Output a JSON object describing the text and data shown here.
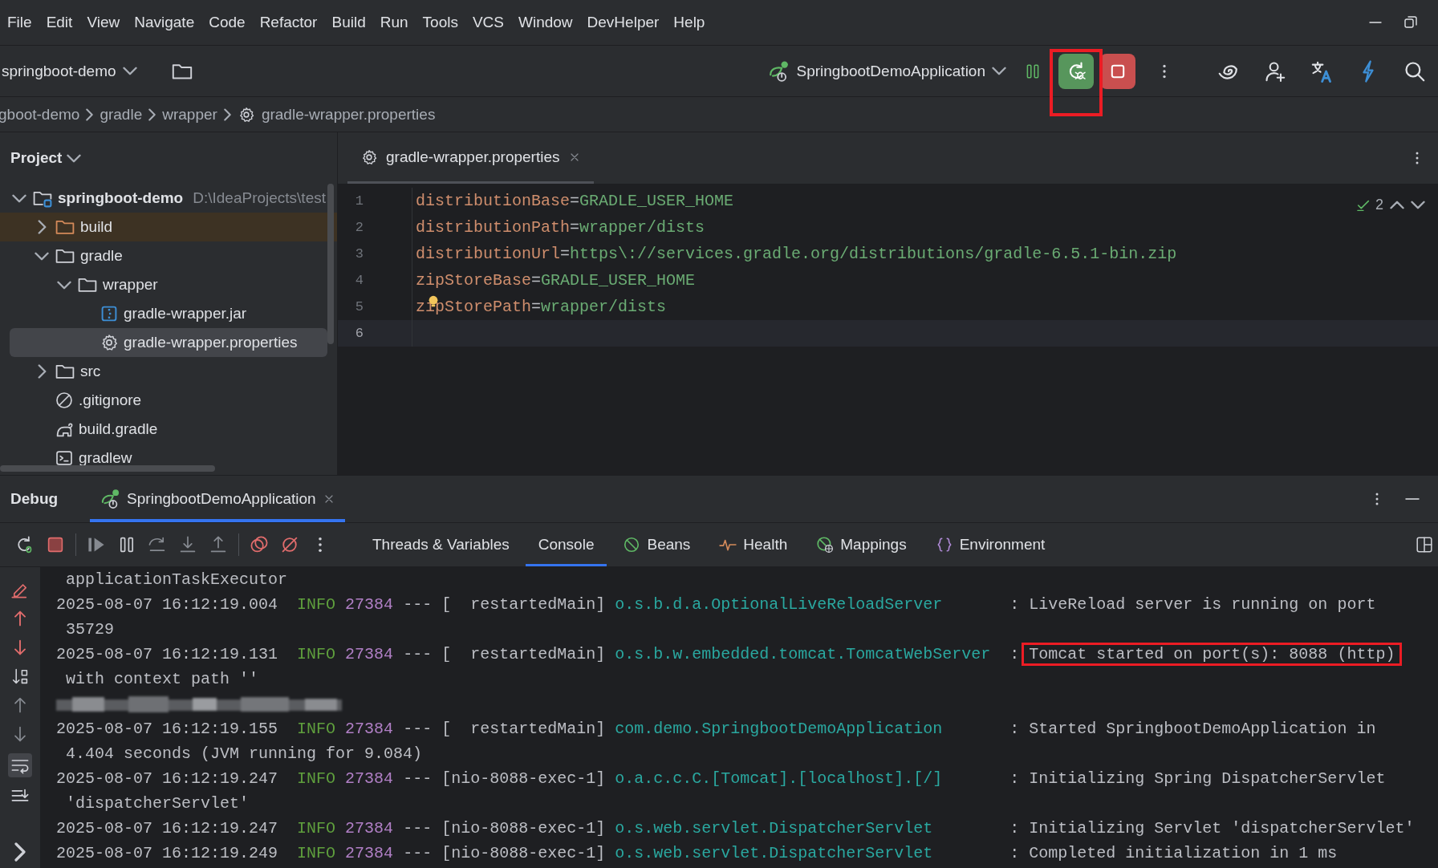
{
  "menu": [
    "File",
    "Edit",
    "View",
    "Navigate",
    "Code",
    "Refactor",
    "Build",
    "Run",
    "Tools",
    "VCS",
    "Window",
    "DevHelper",
    "Help"
  ],
  "toolbar": {
    "project": "springboot-demo",
    "run_config": "SpringbootDemoApplication",
    "buttons": [
      {
        "kind": "debug",
        "highlighted": true
      },
      {
        "kind": "stop"
      }
    ]
  },
  "breadcrumbs": [
    "gboot-demo",
    "gradle",
    "wrapper",
    "gradle-wrapper.properties"
  ],
  "project": {
    "title": "Project",
    "tree": [
      {
        "label": "springboot-demo",
        "kind": "module",
        "path": "D:\\IdeaProjects\\test",
        "expanded": true,
        "selected": false,
        "children": [
          {
            "label": "build",
            "kind": "excluded",
            "expanded": false,
            "selected": false
          },
          {
            "label": "gradle",
            "kind": "folder",
            "expanded": true,
            "selected": false,
            "children": [
              {
                "label": "wrapper",
                "kind": "folder",
                "expanded": true,
                "selected": false,
                "children": [
                  {
                    "label": "gradle-wrapper.jar",
                    "kind": "jar",
                    "selected": false
                  },
                  {
                    "label": "gradle-wrapper.properties",
                    "kind": "properties",
                    "selected": true
                  }
                ]
              }
            ]
          },
          {
            "label": "src",
            "kind": "folder",
            "expanded": false,
            "selected": false
          },
          {
            "label": ".gitignore",
            "kind": "ignore",
            "selected": false
          },
          {
            "label": "build.gradle",
            "kind": "gradle",
            "selected": false
          },
          {
            "label": "gradlew",
            "kind": "script",
            "selected": false
          }
        ]
      }
    ]
  },
  "editor": {
    "tabs": [
      {
        "label": "gradle-wrapper.properties",
        "selected": true
      }
    ],
    "inspections": "2",
    "lines": [
      {
        "number": "1",
        "key": "distributionBase",
        "eq": "=",
        "value": "GRADLE_USER_HOME",
        "current": false
      },
      {
        "number": "2",
        "key": "distributionPath",
        "eq": "=",
        "value": "wrapper/dists",
        "current": false
      },
      {
        "number": "3",
        "key": "distributionUrl",
        "eq": "=",
        "value": "https\\://services.gradle.org/distributions/gradle-6.5.1-bin.zip",
        "current": false
      },
      {
        "number": "4",
        "key": "zipStoreBase",
        "eq": "=",
        "value": "GRADLE_USER_HOME",
        "current": false
      },
      {
        "number": "5",
        "key": "zipStorePath",
        "eq": "=",
        "value": "wrapper/dists",
        "current": false,
        "bulb": true
      },
      {
        "number": "6",
        "current": true
      }
    ]
  },
  "debug": {
    "title": "Debug",
    "sessions": [
      {
        "label": "SpringbootDemoApplication",
        "selected": true
      }
    ],
    "tabs": [
      {
        "label": "Threads & Variables",
        "kind": "plain",
        "selected": false
      },
      {
        "label": "Console",
        "kind": "plain",
        "selected": true
      },
      {
        "label": "Beans",
        "kind": "beans",
        "selected": false
      },
      {
        "label": "Health",
        "kind": "health",
        "selected": false
      },
      {
        "label": "Mappings",
        "kind": "mappings",
        "selected": false
      },
      {
        "label": "Environment",
        "kind": "environment",
        "selected": false
      }
    ],
    "console": [
      {
        "kind": "wrap",
        "text": "applicationTaskExecutor"
      },
      {
        "kind": "entry",
        "time": "2025-08-07 16:12:19.004",
        "level": "INFO",
        "pid": "27384",
        "dashes": "---",
        "thread": "[  restartedMain]",
        "logger": "o.s.b.d.a.OptionalLiveReloadServer",
        "colon": ":",
        "message": "LiveReload server is running on port"
      },
      {
        "kind": "wrap",
        "text": "35729"
      },
      {
        "kind": "entry",
        "time": "2025-08-07 16:12:19.131",
        "level": "INFO",
        "pid": "27384",
        "dashes": "---",
        "thread": "[  restartedMain]",
        "logger": "o.s.b.w.embedded.tomcat.TomcatWebServer",
        "colon": ":",
        "message": "Tomcat started on port(s): 8088 (http)",
        "highlighted": true
      },
      {
        "kind": "wrap",
        "text": "with context path ''"
      },
      {
        "kind": "redacted"
      },
      {
        "kind": "entry",
        "time": "2025-08-07 16:12:19.155",
        "level": "INFO",
        "pid": "27384",
        "dashes": "---",
        "thread": "[  restartedMain]",
        "logger": "com.demo.SpringbootDemoApplication",
        "colon": ":",
        "message": "Started SpringbootDemoApplication in"
      },
      {
        "kind": "wrap",
        "text": "4.404 seconds (JVM running for 9.084)"
      },
      {
        "kind": "entry",
        "time": "2025-08-07 16:12:19.247",
        "level": "INFO",
        "pid": "27384",
        "dashes": "---",
        "thread": "[nio-8088-exec-1]",
        "logger": "o.a.c.c.C.[Tomcat].[localhost].[/]",
        "colon": ":",
        "message": "Initializing Spring DispatcherServlet"
      },
      {
        "kind": "wrap",
        "text": "'dispatcherServlet'"
      },
      {
        "kind": "entry",
        "time": "2025-08-07 16:12:19.247",
        "level": "INFO",
        "pid": "27384",
        "dashes": "---",
        "thread": "[nio-8088-exec-1]",
        "logger": "o.s.web.servlet.DispatcherServlet",
        "colon": ":",
        "message": "Initializing Servlet 'dispatcherServlet'"
      },
      {
        "kind": "entry",
        "time": "2025-08-07 16:12:19.249",
        "level": "INFO",
        "pid": "27384",
        "dashes": "---",
        "thread": "[nio-8088-exec-1]",
        "logger": "o.s.web.servlet.DispatcherServlet",
        "colon": ":",
        "message": "Completed initialization in 1 ms"
      }
    ]
  }
}
